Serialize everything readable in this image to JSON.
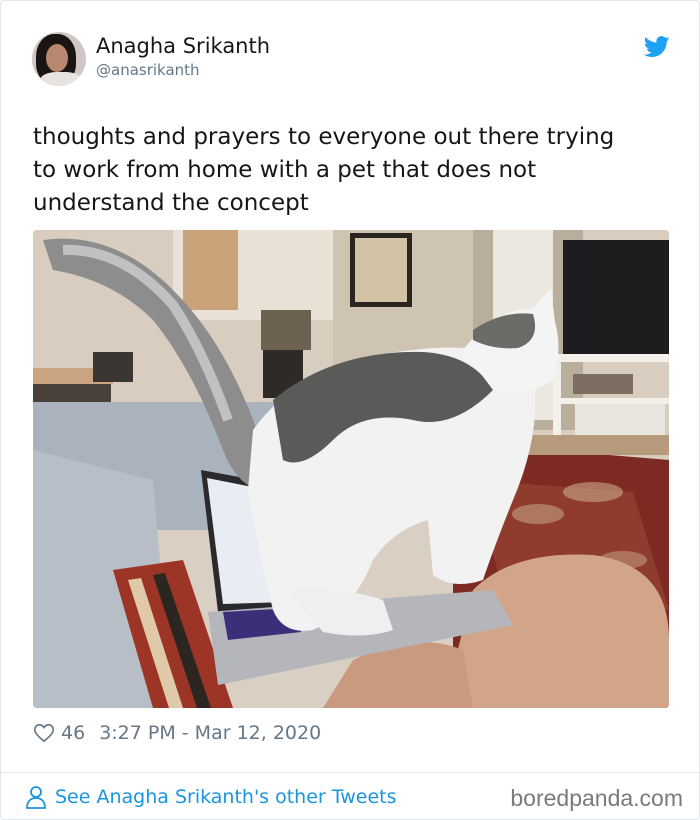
{
  "tweet": {
    "author_name": "Anagha Srikanth",
    "author_handle": "@anasrikanth",
    "text_lines": [
      "thoughts and prayers to everyone out there trying",
      "to work from home with a pet that does not",
      "understand the concept"
    ],
    "likes": "46",
    "timestamp": "3:27 PM - Mar 12, 2020"
  },
  "footer": {
    "see_more_label": "See Anagha Srikanth's other Tweets",
    "watermark": "boredpanda.com"
  },
  "icons": {
    "brand": "twitter-bird-icon",
    "like": "heart-icon",
    "profile": "person-icon"
  },
  "colors": {
    "twitter_blue": "#1da1f2",
    "link_blue": "#1b95e0",
    "secondary_text": "#657786",
    "primary_text": "#14171a",
    "border": "#e1e8ed"
  }
}
